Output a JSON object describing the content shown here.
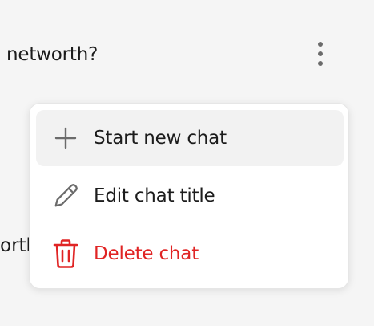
{
  "header": {
    "chat_title": "networth?",
    "more_icon": "more-vertical-icon"
  },
  "background": {
    "partial_text": "orth"
  },
  "menu": {
    "items": [
      {
        "label": "Start new chat",
        "icon": "plus-icon"
      },
      {
        "label": "Edit chat title",
        "icon": "pencil-icon"
      },
      {
        "label": "Delete chat",
        "icon": "trash-icon"
      }
    ]
  },
  "colors": {
    "danger": "#e02424",
    "text": "#1c1c1c",
    "icon": "#6b6b6b",
    "hover_bg": "#f2f2f2"
  }
}
